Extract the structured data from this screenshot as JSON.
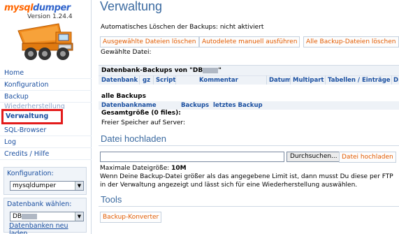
{
  "app": {
    "logo_part1": "mysql",
    "logo_part2": "dumper",
    "version": "Version 1.24.4"
  },
  "nav": [
    {
      "label": "Home"
    },
    {
      "label": "Konfiguration"
    },
    {
      "label": "Backup"
    },
    {
      "label": "Wiederherstellung"
    },
    {
      "label": "Verwaltung"
    },
    {
      "label": "SQL-Browser"
    },
    {
      "label": "Log"
    },
    {
      "label": "Credits / Hilfe"
    }
  ],
  "config_panel": {
    "label": "Konfiguration:",
    "value": "mysqldumper"
  },
  "db_panel": {
    "label": "Datenbank wählen:",
    "value": "DB",
    "reload_link": "Datenbanken neu laden"
  },
  "main": {
    "title": "Verwaltung",
    "auto_delete": "Automatisches Löschen der Backups: nicht aktiviert",
    "btn_delete_selected": "Ausgewählte Dateien löschen",
    "btn_autodelete": "Autodelete manuell ausführen",
    "btn_delete_all": "Alle Backup-Dateien löschen",
    "selected_file": "Gewählte Datei:",
    "db_backups_title": "Datenbank-Backups von \"DB",
    "db_backups_title_end": "\"",
    "columns": [
      "Datenbank",
      "gz",
      "Script",
      "Kommentar",
      "Datum",
      "Multipart",
      "Tabellen / Einträge",
      "D"
    ],
    "all_backups": "alle Backups",
    "all_columns": [
      "Datenbankname",
      "Backups",
      "letztes Backup"
    ],
    "total_size": "Gesamtgröße (0 files):",
    "free_space": "Freier Speicher auf Server:",
    "upload_title": "Datei hochladen",
    "browse": "Durchsuchen...",
    "upload_btn": "Datei hochladen",
    "max_size_label": "Maximale Dateigröße:",
    "max_size_value": "10M",
    "info_text": "Wenn Deine Backup-Datei größer als das angegebene Limit ist, dann musst Du diese per FTP in der Verwaltung angezeigt und lässt sich für eine Wiederherstellung auswählen.",
    "tools_title": "Tools",
    "backup_converter": "Backup-Konverter"
  }
}
